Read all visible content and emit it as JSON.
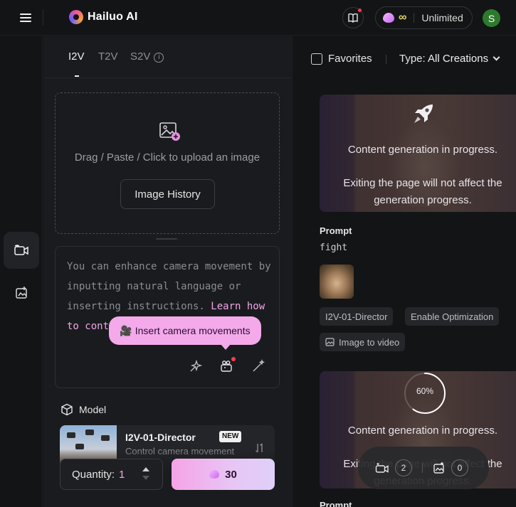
{
  "header": {
    "app_name": "Hailuo AI",
    "plan_label": "Unlimited",
    "plan_infinity": "∞",
    "avatar_initial": "S"
  },
  "left_panel": {
    "tabs": [
      {
        "label": "I2V",
        "active": true
      },
      {
        "label": "T2V",
        "active": false
      },
      {
        "label": "S2V",
        "active": false
      }
    ],
    "s2v_info": "i",
    "upload": {
      "hint": "Drag / Paste / Click to upload an image",
      "history_button": "Image History"
    },
    "prompt": {
      "placeholder": "You can enhance camera movement by inputting natural language or inserting instructions. ",
      "link_text": "Learn how to control",
      "tooltip": "🎥 Insert camera movements"
    },
    "model": {
      "section_label": "Model",
      "name": "I2V-01-Director",
      "badge": "NEW",
      "description": "Control camera movement"
    },
    "quantity_label": "Quantity:",
    "quantity_value": "1",
    "generate_cost": "30"
  },
  "right_panel": {
    "favorites_label": "Favorites",
    "type_label": "Type:",
    "type_value": "All Creations",
    "cards": [
      {
        "status": "Content generation in progress.",
        "note": "Exiting the page will not affect the generation progress.",
        "prompt_label": "Prompt",
        "prompt": "fight",
        "tags": [
          "I2V-01-Director",
          "Enable Optimization"
        ],
        "mode_tag": "Image to video"
      },
      {
        "progress_text": "60%",
        "progress": 0.6,
        "status": "Content generation in progress.",
        "note": "Exiting the page will not affect the generation progress.",
        "prompt_label": "Prompt"
      }
    ],
    "queue": {
      "video_count": "2",
      "image_count": "0"
    }
  },
  "colors": {
    "accent_pink": "#f4a9ea",
    "background": "#131416",
    "panel": "#1a1b1e",
    "avatar": "#2d7a2d"
  }
}
